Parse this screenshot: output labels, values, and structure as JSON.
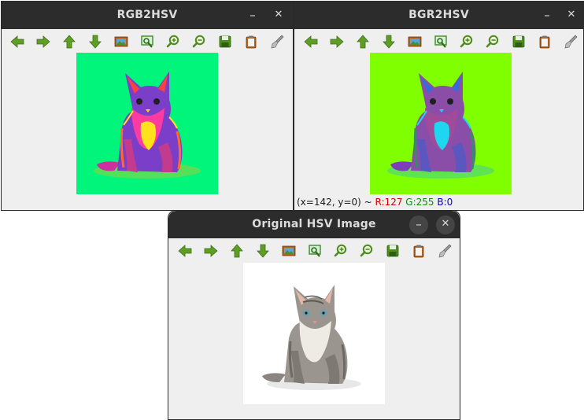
{
  "windows": {
    "rgb2hsv": {
      "title": "RGB2HSV"
    },
    "bgr2hsv": {
      "title": "BGR2HSV",
      "status": {
        "coords": "(x=142, y=0) ~",
        "r": "R:127",
        "g": "G:255",
        "b": "B:0"
      }
    },
    "original": {
      "title": "Original HSV Image"
    }
  },
  "controls": {
    "minimize": "–",
    "close": "✕"
  },
  "toolbar_icons": [
    "arrow-left-icon",
    "arrow-right-icon",
    "arrow-up-icon",
    "arrow-down-icon",
    "image-icon",
    "zoom-rect-icon",
    "zoom-in-icon",
    "zoom-out-icon",
    "save-icon",
    "clipboard-icon",
    "brush-icon"
  ],
  "colors": {
    "titlebar": "#2c2c2c",
    "panel": "#efefef",
    "icon_green": "#5f9e25",
    "rgb2hsv_bg": "#00f57a",
    "bgr2hsv_bg": "#80ff00",
    "status_r": "#d40000",
    "status_g": "#0a8a0a",
    "status_b": "#0000d4"
  }
}
